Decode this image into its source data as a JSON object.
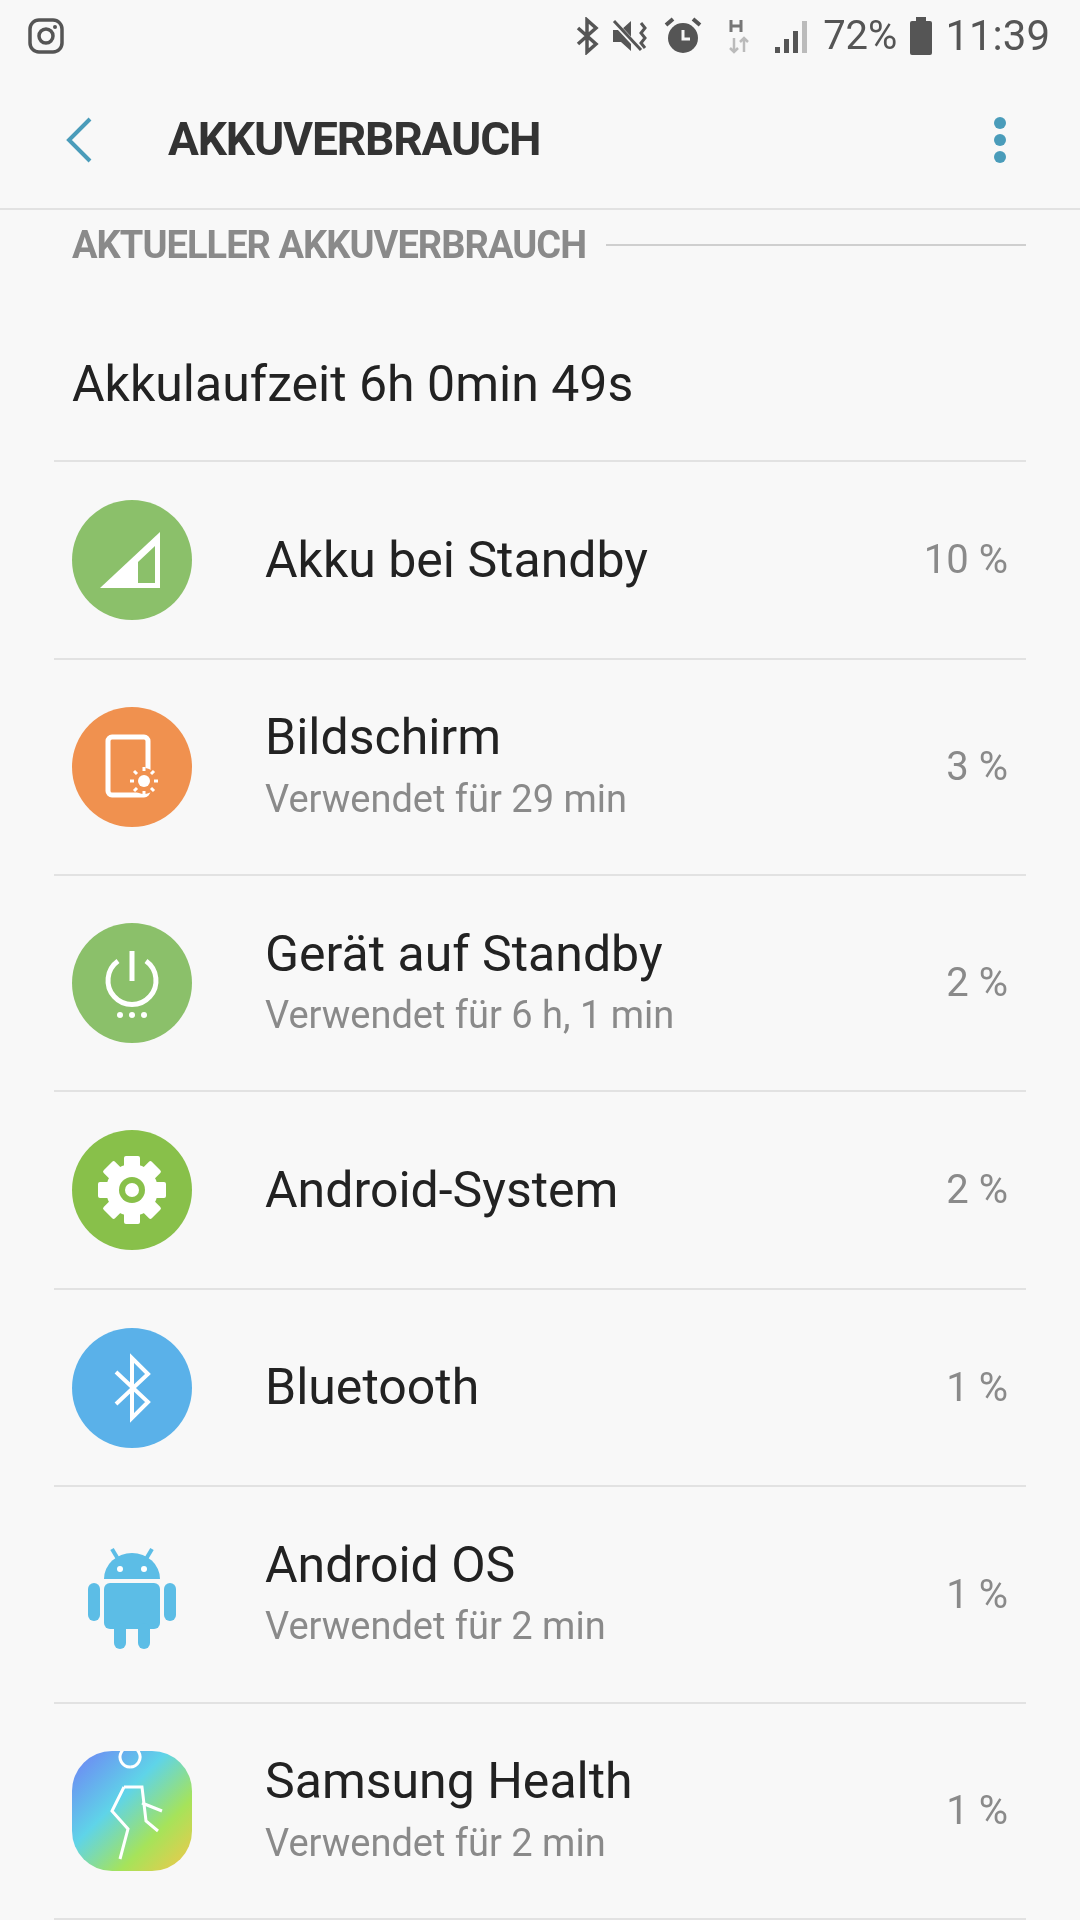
{
  "status_bar": {
    "battery": "72%",
    "time": "11:39"
  },
  "header": {
    "title": "AKKUVERBRAUCH"
  },
  "section": {
    "title": "AKTUELLER AKKUVERBRAUCH"
  },
  "runtime": "Akkulaufzeit 6h 0min 49s",
  "items": [
    {
      "kind": "signal",
      "name": "Akku bei Standby",
      "percent": "10 %"
    },
    {
      "kind": "screen",
      "name": "Bildschirm",
      "detail": "Verwendet für 29 min",
      "percent": "3 %"
    },
    {
      "kind": "power",
      "name": "Gerät auf Standby",
      "detail": "Verwendet für 6 h, 1 min",
      "percent": "2 %"
    },
    {
      "kind": "gear",
      "name": "Android-System",
      "percent": "2 %"
    },
    {
      "kind": "bluetooth",
      "name": "Bluetooth",
      "percent": "1 %"
    },
    {
      "kind": "android",
      "name": "Android OS",
      "detail": "Verwendet für 2 min",
      "percent": "1 %"
    },
    {
      "kind": "health",
      "name": "Samsung Health",
      "detail": "Verwendet für 2 min",
      "percent": "1 %"
    }
  ]
}
